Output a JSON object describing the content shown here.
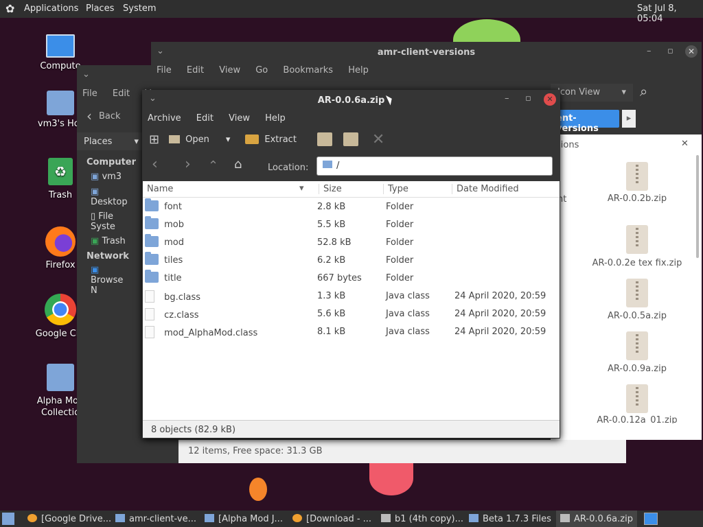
{
  "topbar": {
    "apps": "Applications",
    "places": "Places",
    "system": "System",
    "clock": "Sat Jul 8, 05:04"
  },
  "desktop": {
    "icons": [
      "Computer",
      "vm3's Home",
      "Trash",
      "Firefox",
      "Google Chrome",
      "Alpha Mod Collection"
    ],
    "icons_visible": {
      "computer": "Compute",
      "home": "vm3's Hor",
      "trash": "Trash",
      "firefox": "Firefox",
      "chrome": "Google Chr",
      "alpha1": "Alpha Mod",
      "alpha2": "Collectio"
    }
  },
  "caja_back": {
    "menu": [
      "File",
      "Edit",
      "V"
    ],
    "back": "Back",
    "places": "Places",
    "side": {
      "computer": "Computer",
      "vm3": "vm3",
      "desktop": "Desktop",
      "fs": "File Syste",
      "trash": "Trash",
      "network": "Network",
      "browse": "Browse N"
    }
  },
  "caja_front": {
    "title": "amr-client-versions",
    "menu": [
      "File",
      "Edit",
      "View",
      "Go",
      "Bookmarks",
      "Help"
    ],
    "view": "Icon View",
    "path_button": "ent-versions",
    "pane_label": "sions",
    "pane_label2": "nt",
    "status": "12 items, Free space: 31.3 GB",
    "files": [
      "AR-0.0.2b.zip",
      "AR-0.0.2e tex fix.zip",
      "AR-0.0.5a.zip",
      "AR-0.0.9a.zip",
      "AR-0.0.12a_01.zip"
    ]
  },
  "archive": {
    "title": "AR-0.0.6a.zip",
    "menu": [
      "Archive",
      "Edit",
      "View",
      "Help"
    ],
    "toolbar": {
      "open": "Open",
      "extract": "Extract"
    },
    "location_label": "Location:",
    "location": "/",
    "columns": {
      "name": "Name",
      "size": "Size",
      "type": "Type",
      "date": "Date Modified"
    },
    "rows": [
      {
        "name": "font",
        "size": "2.8 kB",
        "type": "Folder",
        "date": "",
        "kind": "folder"
      },
      {
        "name": "mob",
        "size": "5.5 kB",
        "type": "Folder",
        "date": "",
        "kind": "folder"
      },
      {
        "name": "mod",
        "size": "52.8 kB",
        "type": "Folder",
        "date": "",
        "kind": "folder"
      },
      {
        "name": "tiles",
        "size": "6.2 kB",
        "type": "Folder",
        "date": "",
        "kind": "folder"
      },
      {
        "name": "title",
        "size": "667 bytes",
        "type": "Folder",
        "date": "",
        "kind": "folder"
      },
      {
        "name": "bg.class",
        "size": "1.3 kB",
        "type": "Java class",
        "date": "24 April 2020, 20:59",
        "kind": "file"
      },
      {
        "name": "cz.class",
        "size": "5.6 kB",
        "type": "Java class",
        "date": "24 April 2020, 20:59",
        "kind": "file"
      },
      {
        "name": "mod_AlphaMod.class",
        "size": "8.1 kB",
        "type": "Java class",
        "date": "24 April 2020, 20:59",
        "kind": "file"
      }
    ],
    "status": "8 objects (82.9 kB)"
  },
  "taskbar": [
    "[Google Drive...",
    "amr-client-ve...",
    "[Alpha Mod J...",
    "[Download - ...",
    "b1 (4th copy)...",
    "Beta 1.7.3 Files",
    "AR-0.0.6a.zip"
  ],
  "colors": {
    "panel": "#2f2f2f",
    "window_dark": "#353535",
    "accent": "#3b8ee8",
    "close": "#e04c4c"
  }
}
